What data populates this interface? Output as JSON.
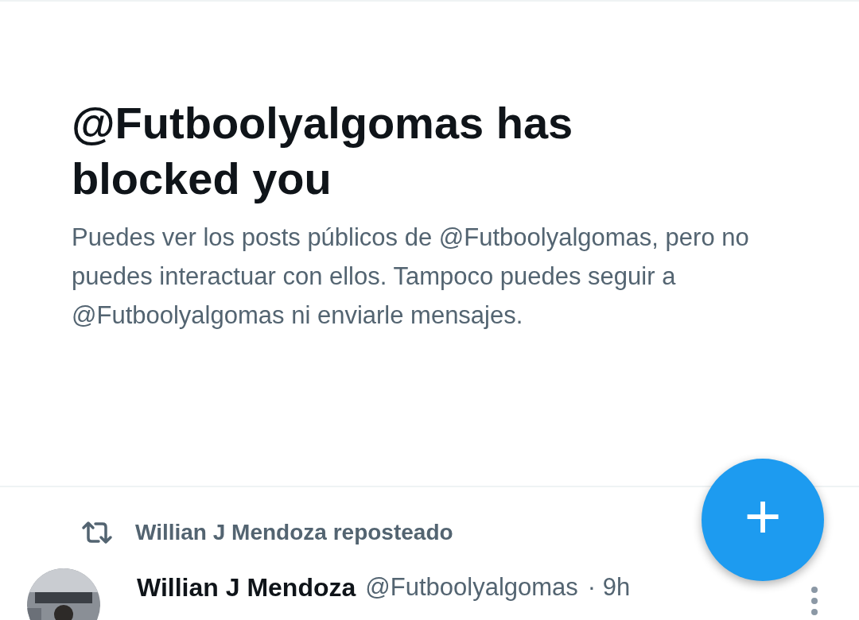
{
  "heading": "@Futboolyalgomas has blocked you",
  "message": "Puedes ver los posts públicos de @Futboolyalgomas, pero no puedes interactuar con ellos. Tampoco puedes seguir a @Futboolyalgomas ni enviarle mensajes.",
  "repost": {
    "label": "Willian J Mendoza reposteado"
  },
  "post": {
    "author": "Willian J Mendoza",
    "handle": "@Futboolyalgomas",
    "time": "· 9h"
  },
  "compose_button": {
    "label": "+"
  }
}
